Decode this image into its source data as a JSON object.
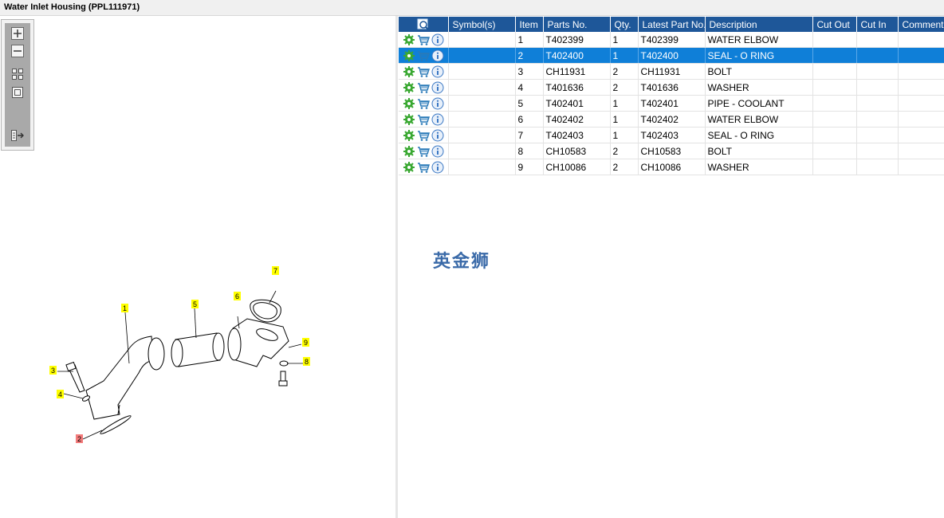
{
  "window": {
    "title": "Water Inlet Housing (PPL111971)"
  },
  "diagram": {
    "callouts": [
      {
        "label": "1",
        "color": "#ffff00"
      },
      {
        "label": "5",
        "color": "#ffff00"
      },
      {
        "label": "6",
        "color": "#ffff00"
      },
      {
        "label": "7",
        "color": "#ffff00"
      },
      {
        "label": "3",
        "color": "#ffff00"
      },
      {
        "label": "4",
        "color": "#ffff00"
      },
      {
        "label": "9",
        "color": "#ffff00"
      },
      {
        "label": "8",
        "color": "#ffff00"
      },
      {
        "label": "2",
        "color": "#f47c7c"
      }
    ]
  },
  "table": {
    "columns": [
      "",
      "Symbol(s)",
      "Item",
      "Parts No.",
      "Qty.",
      "Latest Part No.",
      "Description",
      "Cut Out",
      "Cut In",
      "Comment"
    ],
    "selected_index": 1,
    "rows": [
      {
        "item": "1",
        "part": "T402399",
        "qty": "1",
        "latest": "T402399",
        "desc": "WATER ELBOW"
      },
      {
        "item": "2",
        "part": "T402400",
        "qty": "1",
        "latest": "T402400",
        "desc": "SEAL - O RING"
      },
      {
        "item": "3",
        "part": "CH11931",
        "qty": "2",
        "latest": "CH11931",
        "desc": "BOLT"
      },
      {
        "item": "4",
        "part": "T401636",
        "qty": "2",
        "latest": "T401636",
        "desc": "WASHER"
      },
      {
        "item": "5",
        "part": "T402401",
        "qty": "1",
        "latest": "T402401",
        "desc": "PIPE - COOLANT"
      },
      {
        "item": "6",
        "part": "T402402",
        "qty": "1",
        "latest": "T402402",
        "desc": "WATER ELBOW"
      },
      {
        "item": "7",
        "part": "T402403",
        "qty": "1",
        "latest": "T402403",
        "desc": "SEAL - O RING"
      },
      {
        "item": "8",
        "part": "CH10583",
        "qty": "2",
        "latest": "CH10583",
        "desc": "BOLT"
      },
      {
        "item": "9",
        "part": "CH10086",
        "qty": "2",
        "latest": "CH10086",
        "desc": "WASHER"
      }
    ]
  },
  "watermark": "英金狮",
  "colors": {
    "header": "#1e5799",
    "selected": "#0f7fd8",
    "gear": "#3aa832",
    "cart": "#2a7ab8",
    "info": "#3b78c4"
  },
  "icons": [
    "gear-icon",
    "cart-icon",
    "info-icon",
    "search-icon",
    "zoom-in-icon",
    "zoom-out-icon",
    "fit-icon",
    "actual-size-icon",
    "export-icon"
  ]
}
